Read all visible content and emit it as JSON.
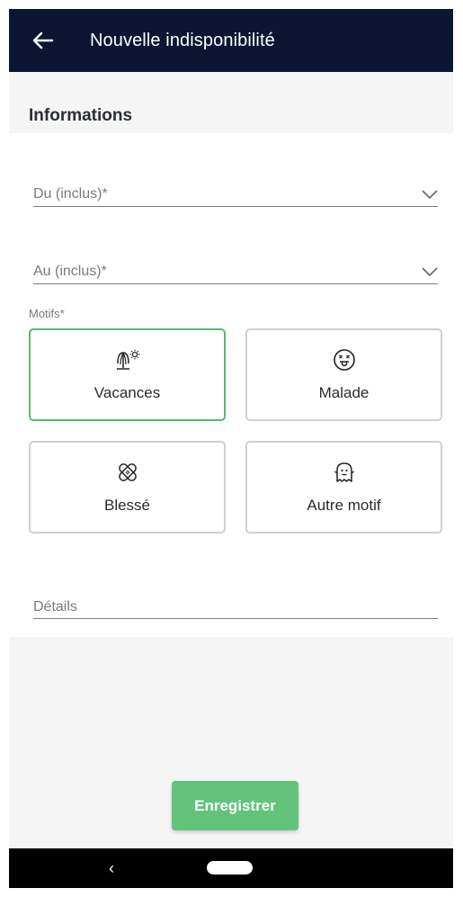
{
  "appbar": {
    "title": "Nouvelle indisponibilité",
    "back_icon": "arrow-left-icon",
    "background": "#0c1633"
  },
  "section": {
    "title": "Informations"
  },
  "form": {
    "from_field": {
      "label": "Du (inclus)*",
      "icon": "chevron-down-icon"
    },
    "to_field": {
      "label": "Au (inclus)*",
      "icon": "chevron-down-icon"
    },
    "reasons_label": "Motifs*",
    "reasons": [
      {
        "label": "Vacances",
        "icon": "beach-umbrella-sun-icon",
        "selected": true
      },
      {
        "label": "Malade",
        "icon": "sick-face-icon",
        "selected": false
      },
      {
        "label": "Blessé",
        "icon": "bandage-icon",
        "selected": false
      },
      {
        "label": "Autre motif",
        "icon": "ghost-icon",
        "selected": false
      }
    ],
    "details_placeholder": "Détails"
  },
  "actions": {
    "save_label": "Enregistrer"
  },
  "system_nav": {
    "back_glyph": "‹",
    "back_icon": "nav-back-icon",
    "home_icon": "home-pill-icon"
  },
  "colors": {
    "accent_green": "#62c47b",
    "selected_border": "#5ab86c",
    "header_navy": "#0c1633"
  }
}
